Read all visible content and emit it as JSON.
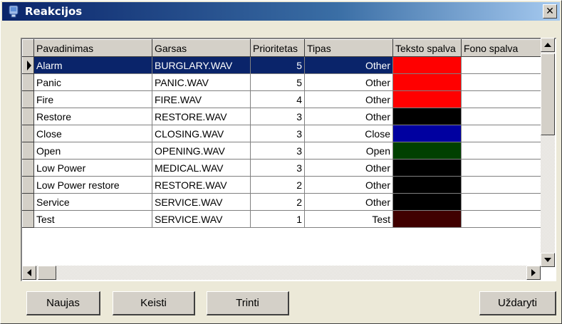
{
  "window": {
    "title": "Reakcijos",
    "close_glyph": "✕"
  },
  "grid": {
    "columns": [
      "Pavadinimas",
      "Garsas",
      "Prioritetas",
      "Tipas",
      "Teksto spalva",
      "Fono spalva"
    ],
    "rows": [
      {
        "name": "Alarm",
        "sound": "BURGLARY.WAV",
        "priority": "5",
        "type": "Other",
        "text_color": "#ff0000",
        "bg_color": "#ffffff",
        "selected": true
      },
      {
        "name": "Panic",
        "sound": "PANIC.WAV",
        "priority": "5",
        "type": "Other",
        "text_color": "#ff0000",
        "bg_color": "#ffffff"
      },
      {
        "name": "Fire",
        "sound": "FIRE.WAV",
        "priority": "4",
        "type": "Other",
        "text_color": "#ff0000",
        "bg_color": "#ffffff"
      },
      {
        "name": "Restore",
        "sound": "RESTORE.WAV",
        "priority": "3",
        "type": "Other",
        "text_color": "#000000",
        "bg_color": "#ffffff"
      },
      {
        "name": "Close",
        "sound": "CLOSING.WAV",
        "priority": "3",
        "type": "Close",
        "text_color": "#0000a0",
        "bg_color": "#ffffff"
      },
      {
        "name": "Open",
        "sound": "OPENING.WAV",
        "priority": "3",
        "type": "Open",
        "text_color": "#004000",
        "bg_color": "#ffffff"
      },
      {
        "name": "Low Power",
        "sound": "MEDICAL.WAV",
        "priority": "3",
        "type": "Other",
        "text_color": "#000000",
        "bg_color": "#ffffff"
      },
      {
        "name": "Low Power restore",
        "sound": "RESTORE.WAV",
        "priority": "2",
        "type": "Other",
        "text_color": "#000000",
        "bg_color": "#ffffff"
      },
      {
        "name": "Service",
        "sound": "SERVICE.WAV",
        "priority": "2",
        "type": "Other",
        "text_color": "#000000",
        "bg_color": "#ffffff"
      },
      {
        "name": "Test",
        "sound": "SERVICE.WAV",
        "priority": "1",
        "type": "Test",
        "text_color": "#400000",
        "bg_color": "#ffffff"
      }
    ]
  },
  "buttons": {
    "new": "Naujas",
    "edit": "Keisti",
    "delete": "Trinti",
    "close": "Uždaryti"
  },
  "colors": {
    "selection": "#0a246a",
    "title_gradient_start": "#0a246a",
    "title_gradient_end": "#a6caf0",
    "face": "#d4d0c8"
  }
}
